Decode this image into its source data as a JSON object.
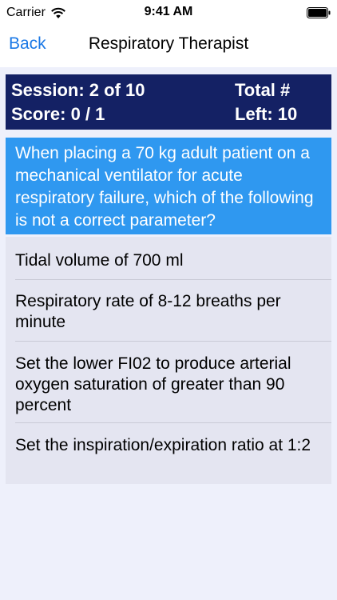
{
  "status_bar": {
    "carrier": "Carrier",
    "time": "9:41 AM",
    "wifi_icon": "wifi-icon",
    "battery_icon": "battery-icon"
  },
  "nav": {
    "back_label": "Back",
    "title": "Respiratory Therapist"
  },
  "score_panel": {
    "session": "Session: 2 of 10",
    "score": "Score: 0 / 1",
    "total_label": "Total #",
    "left": "Left: 10"
  },
  "question": {
    "text": "When placing a 70 kg adult patient on a mechanical ventilator for acute respiratory failure, which of the following is not a correct parameter?"
  },
  "answers": [
    {
      "text": "Tidal volume of 700 ml"
    },
    {
      "text": "Respiratory rate of 8-12 breaths per minute"
    },
    {
      "text": "Set the lower FI02 to produce arterial oxygen saturation of greater than 90 percent"
    },
    {
      "text": "Set the inspiration/expiration ratio at 1:2"
    }
  ],
  "colors": {
    "accent": "#1a78e6",
    "score_panel_bg": "#142164",
    "question_bg": "#2f98f0",
    "answers_bg": "#e4e5f1",
    "page_bg": "#eef0fb"
  }
}
